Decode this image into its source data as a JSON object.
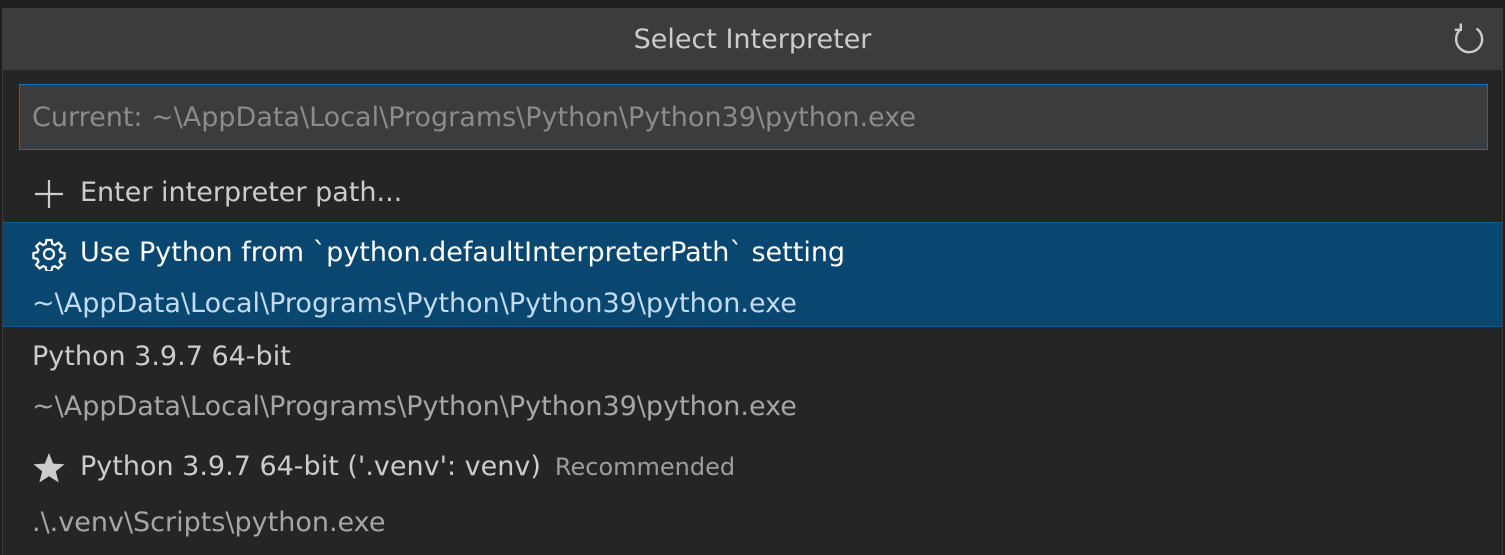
{
  "title": "Select Interpreter",
  "refresh_icon": "refresh-icon",
  "input": {
    "placeholder": "Current: ~\\AppData\\Local\\Programs\\Python\\Python39\\python.exe",
    "value": ""
  },
  "items": [
    {
      "icon": "plus-icon",
      "label": "Enter interpreter path..."
    },
    {
      "icon": "gear-icon",
      "label": "Use Python from `python.defaultInterpreterPath` setting",
      "detail": "~\\AppData\\Local\\Programs\\Python\\Python39\\python.exe",
      "selected": true
    },
    {
      "label": "Python 3.9.7 64-bit",
      "detail": "~\\AppData\\Local\\Programs\\Python\\Python39\\python.exe"
    },
    {
      "icon": "star-icon",
      "label": "Python 3.9.7 64-bit ('.venv': venv)",
      "badge": "Recommended",
      "detail": ".\\.venv\\Scripts\\python.exe"
    }
  ],
  "colors": {
    "selection_background": "#094771",
    "focus_border": "#0e70c0",
    "panel_background": "#252526",
    "title_background": "#3c3c3c"
  }
}
